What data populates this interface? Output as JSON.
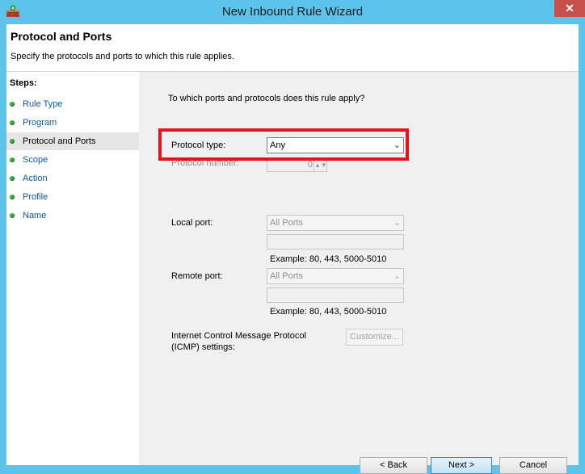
{
  "window": {
    "title": "New Inbound Rule Wizard",
    "close_glyph": "✕"
  },
  "header": {
    "title": "Protocol and Ports",
    "subtitle": "Specify the protocols and ports to which this rule applies."
  },
  "steps": {
    "title": "Steps:",
    "items": [
      {
        "label": "Rule Type"
      },
      {
        "label": "Program"
      },
      {
        "label": "Protocol and Ports",
        "current": true
      },
      {
        "label": "Scope"
      },
      {
        "label": "Action"
      },
      {
        "label": "Profile"
      },
      {
        "label": "Name"
      }
    ]
  },
  "content": {
    "question": "To which ports and protocols does this rule apply?",
    "protocol_type": {
      "label": "Protocol type:",
      "value": "Any"
    },
    "protocol_number": {
      "label": "Protocol number:",
      "value": "0"
    },
    "local_port": {
      "label": "Local port:",
      "value": "All Ports",
      "example": "Example: 80, 443, 5000-5010"
    },
    "remote_port": {
      "label": "Remote port:",
      "value": "All Ports",
      "example": "Example: 80, 443, 5000-5010"
    },
    "icmp": {
      "label_line1": "Internet Control Message Protocol",
      "label_line2": "(ICMP) settings:",
      "button": "Customize..."
    }
  },
  "buttons": {
    "back": "< Back",
    "next": "Next >",
    "cancel": "Cancel"
  },
  "icons": {
    "chevron": "chevron-down-icon",
    "app": "firewall-wizard-icon"
  },
  "colors": {
    "titlebar": "#5cc3ea",
    "highlight": "#e3151a",
    "step_link": "#1155aa",
    "step_dot": "#3cab3c"
  }
}
